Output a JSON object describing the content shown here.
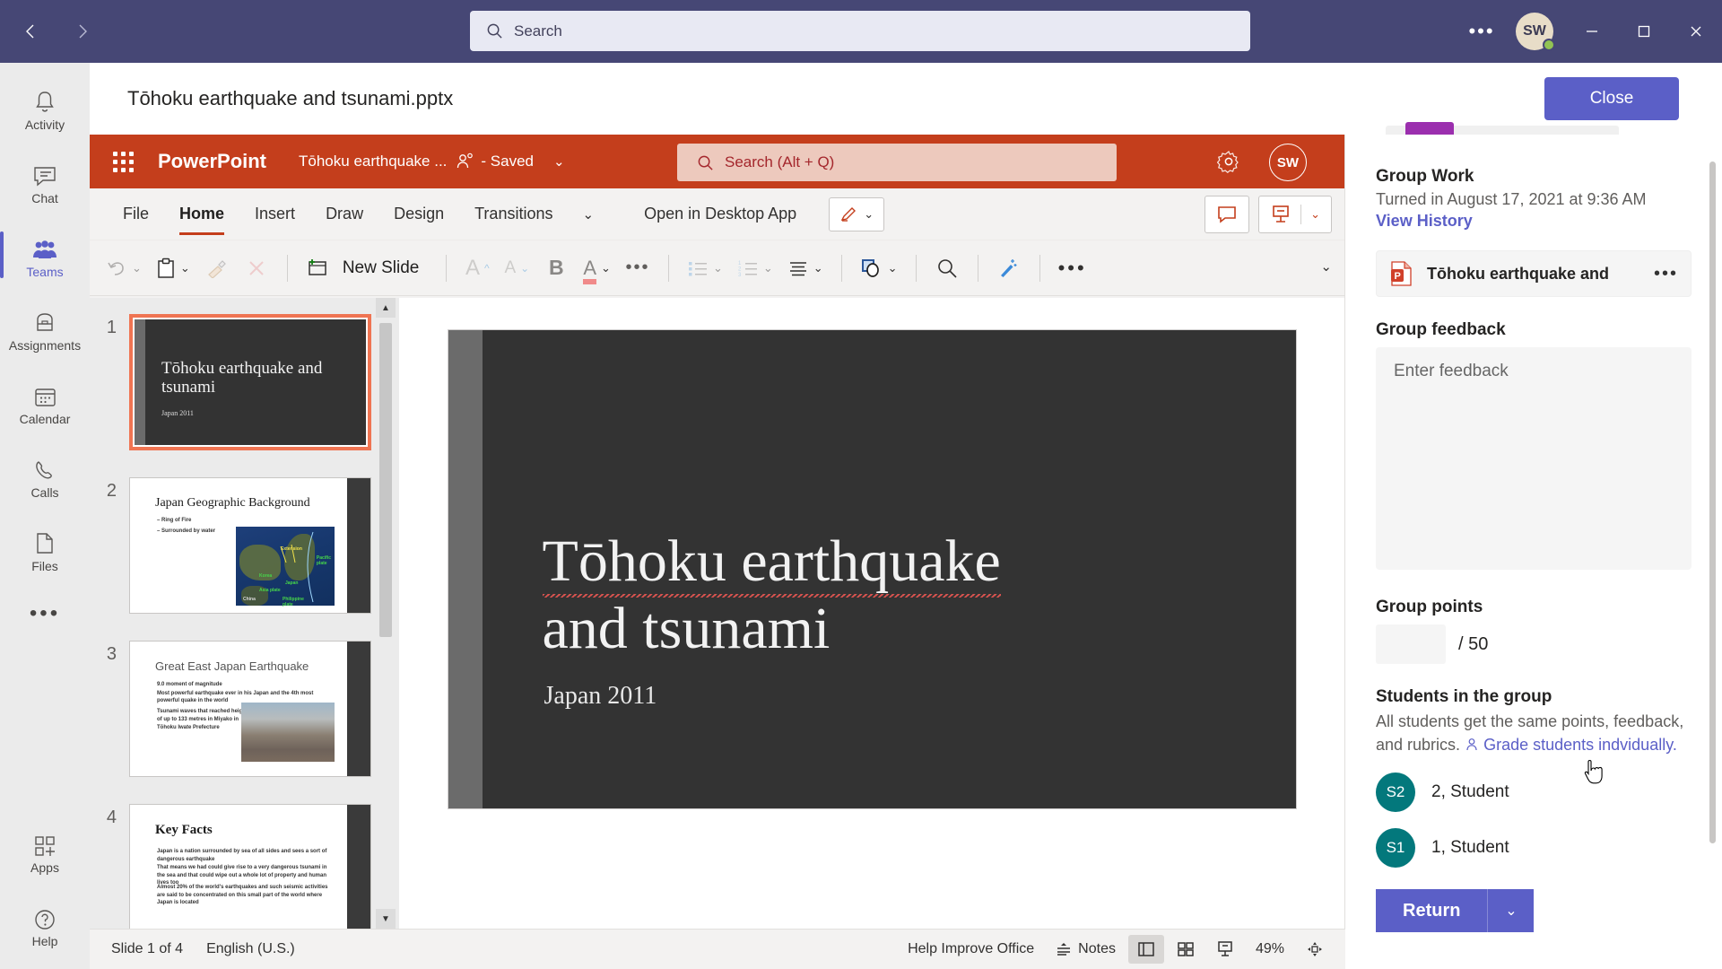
{
  "titlebar": {
    "back_icon": "chevron-left-icon",
    "forward_icon": "chevron-right-icon",
    "search_placeholder": "Search",
    "more_label": "•••",
    "avatar_initials": "SW",
    "minimize_label": "–",
    "maximize_label": "▢",
    "close_label": "✕"
  },
  "rail": {
    "items": [
      {
        "label": "Activity",
        "icon": "bell-icon",
        "active": false
      },
      {
        "label": "Chat",
        "icon": "chat-bubble-icon",
        "active": false
      },
      {
        "label": "Teams",
        "icon": "teams-people-icon",
        "active": true
      },
      {
        "label": "Assignments",
        "icon": "backpack-icon",
        "active": false
      },
      {
        "label": "Calendar",
        "icon": "calendar-icon",
        "active": false
      },
      {
        "label": "Calls",
        "icon": "phone-icon",
        "active": false
      },
      {
        "label": "Files",
        "icon": "file-icon",
        "active": false
      }
    ],
    "more_label": "•••",
    "apps_label": "Apps",
    "help_label": "Help"
  },
  "dochead": {
    "title": "Tōhoku earthquake and tsunami.pptx",
    "close_label": "Close"
  },
  "powerpoint": {
    "brand": "PowerPoint",
    "file_name": "Tōhoku earthquake ...",
    "save_state": "- Saved",
    "search_placeholder": "Search (Alt + Q)",
    "avatar_initials": "SW",
    "tabs": [
      {
        "label": "File",
        "active": false
      },
      {
        "label": "Home",
        "active": true
      },
      {
        "label": "Insert",
        "active": false
      },
      {
        "label": "Draw",
        "active": false
      },
      {
        "label": "Design",
        "active": false
      },
      {
        "label": "Transitions",
        "active": false
      }
    ],
    "tabs_overflow_caret": "⌄",
    "open_in_desktop": "Open in Desktop App",
    "toolbar": {
      "undo": "undo-icon",
      "paste": "paste-icon",
      "format_painter": "format-painter-icon",
      "clear_formatting": "clear-formatting-icon",
      "new_slide": "New Slide",
      "grow_font": "A",
      "shrink_font": "A",
      "bold": "B",
      "font_color": "A",
      "more": "•••",
      "bullets": "bullet-list-icon",
      "numbering": "numbered-list-icon",
      "align": "align-icon",
      "shapes": "shapes-icon",
      "find": "search-icon",
      "designer": "designer-wand-icon",
      "overflow": "•••"
    },
    "comments_icon": "comment-icon",
    "present_icon": "present-icon"
  },
  "thumbnails": [
    {
      "number": "1",
      "title": "Tōhoku earthquake and tsunami",
      "subtitle": "Japan 2011",
      "type": "title-dark",
      "selected": true
    },
    {
      "number": "2",
      "title": "Japan Geographic Background",
      "bullets": [
        "Ring of Fire",
        "Surrounded by water"
      ],
      "type": "content-map",
      "selected": false
    },
    {
      "number": "3",
      "title": "Great East Japan Earthquake",
      "bullets": [
        "9.0 moment of magnitude",
        "Most powerful earthquake ever in his Japan and the 4th most powerful quake in the world",
        "Tsunami waves that reached heights of up to 133 metres in Miyako in Tōhoku Iwate Prefecture"
      ],
      "type": "content-photo",
      "selected": false
    },
    {
      "number": "4",
      "title": "Key Facts",
      "bullets": [
        "Japan is a nation surrounded by sea of all sides and sees a sort of dangerous earthquake",
        "That means we had could give rise to a very dangerous tsunami in the sea and that could wipe out a whole lot of property and human lives too",
        "Almost 20% of the world's earthquakes and such seismic activities are said to be concentrated on this small part of the world where Japan is located"
      ],
      "type": "content-text",
      "selected": false
    }
  ],
  "slide": {
    "title_line1": "Tōhoku earthquake",
    "title_line2": "and tsunami",
    "subtitle": "Japan 2011"
  },
  "statusbar": {
    "slide_counter": "Slide 1 of 4",
    "language": "English (U.S.)",
    "help_improve": "Help Improve Office",
    "notes": "Notes",
    "zoom": "49%",
    "view_normal": "normal-view-icon",
    "view_sorter": "slide-sorter-icon",
    "view_reading": "reading-view-icon",
    "fit_slide": "fit-to-window-icon"
  },
  "grading": {
    "heading": "Group Work",
    "turned_in": "Turned in August 17, 2021 at 9:36 AM",
    "view_history": "View History",
    "file": {
      "name": "Tōhoku earthquake and",
      "icon": "powerpoint-file-icon",
      "more": "•••"
    },
    "feedback_label": "Group feedback",
    "feedback_placeholder": "Enter feedback",
    "feedback_value": "",
    "points_label": "Group points",
    "points_value": "",
    "points_max": "/ 50",
    "students_label": "Students in the group",
    "students_desc_line1": "All students get the same points, feedback,",
    "students_desc_line2": "and rubrics.",
    "grade_individually_link": "Grade students indvidually.",
    "grade_individually_icon": "person-icon",
    "students": [
      {
        "initials": "S2",
        "name": "2, Student"
      },
      {
        "initials": "S1",
        "name": "1, Student"
      }
    ],
    "return_label": "Return",
    "return_caret": "⌄"
  },
  "colors": {
    "teams_purple": "#464775",
    "teams_accent": "#5b5fc7",
    "powerpoint_orange": "#c43e1c",
    "selected_thumb": "#ef7452",
    "student_avatar": "#03787c"
  }
}
